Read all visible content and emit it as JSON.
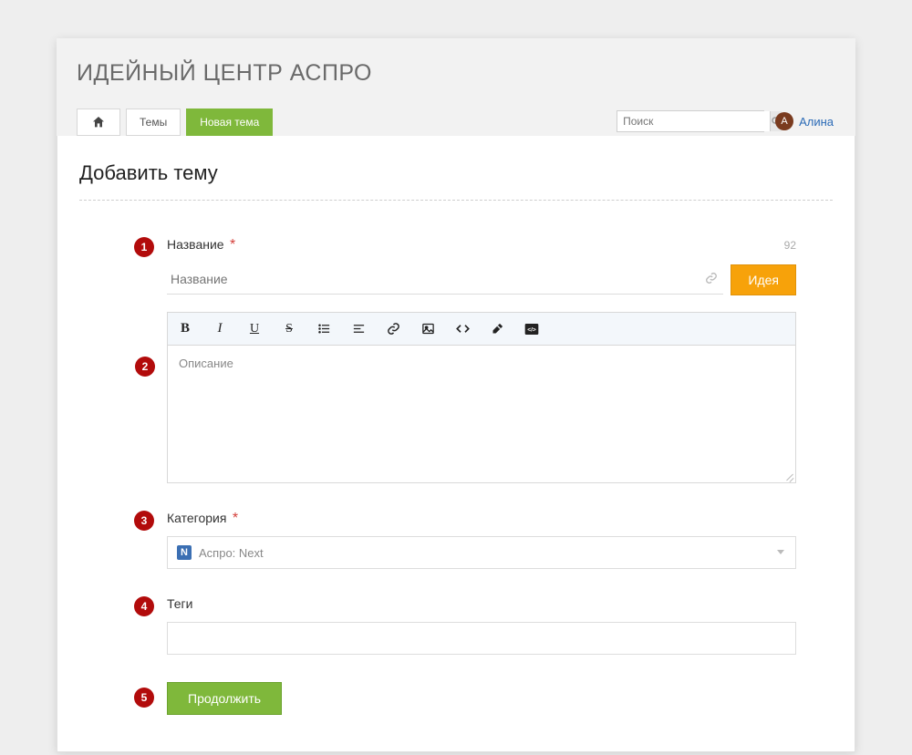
{
  "header": {
    "title": "ИДЕЙНЫЙ ЦЕНТР АСПРО"
  },
  "nav": {
    "themes_label": "Темы",
    "new_theme_label": "Новая тема"
  },
  "search": {
    "placeholder": "Поиск"
  },
  "user": {
    "initial": "А",
    "name": "Алина"
  },
  "page": {
    "heading": "Добавить тему"
  },
  "form": {
    "title": {
      "step": "1",
      "label": "Название",
      "required": "*",
      "char_count": "92",
      "placeholder": "Название",
      "idea_button": "Идея"
    },
    "description": {
      "step": "2",
      "placeholder": "Описание"
    },
    "category": {
      "step": "3",
      "label": "Категория",
      "required": "*",
      "selected_icon_letter": "N",
      "selected": "Аспро: Next"
    },
    "tags": {
      "step": "4",
      "label": "Теги"
    },
    "submit": {
      "step": "5",
      "label": "Продолжить"
    }
  }
}
